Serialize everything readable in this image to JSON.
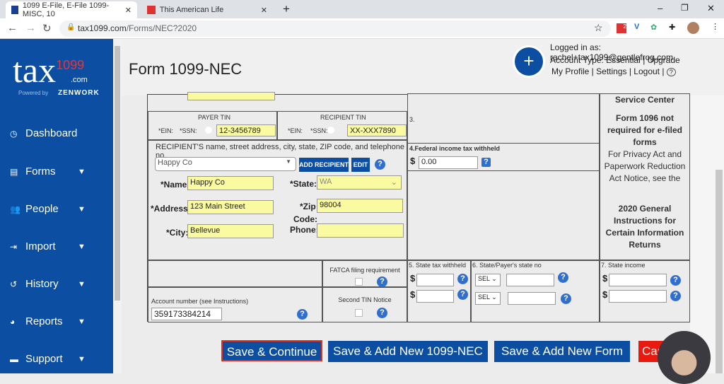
{
  "browser": {
    "tabs": [
      {
        "label": "1099 E-File, E-File 1099-MISC, 10",
        "active": true
      },
      {
        "label": "This American Life",
        "active": false
      }
    ],
    "url_host": "tax1099.com",
    "url_path": "/Forms/NEC?2020",
    "ext_badge": "2"
  },
  "sidebar": {
    "logo": "tax",
    "logo_num": "1099",
    "logo_com": ".com",
    "powered": "Powered by",
    "brand": "ZENWORK",
    "items": [
      {
        "label": "Dashboard",
        "icon": "dashboard-icon",
        "dropdown": false
      },
      {
        "label": "Forms",
        "icon": "forms-icon",
        "dropdown": true
      },
      {
        "label": "People",
        "icon": "people-icon",
        "dropdown": true
      },
      {
        "label": "Import",
        "icon": "import-icon",
        "dropdown": true
      },
      {
        "label": "History",
        "icon": "history-icon",
        "dropdown": true
      },
      {
        "label": "Reports",
        "icon": "reports-icon",
        "dropdown": true
      },
      {
        "label": "Support",
        "icon": "support-icon",
        "dropdown": true
      }
    ]
  },
  "header": {
    "title": "Form 1099-NEC",
    "logged_in": "Logged in as: rachel+tax1099@gentlefrog.com",
    "account_type": "Account Type: Essential",
    "upgrade": "Upgrade",
    "my_profile": "My Profile",
    "settings": "Settings",
    "logout": "Logout",
    "help": "?"
  },
  "form": {
    "payer_tin": "PAYER TIN",
    "recipient_tin": "RECIPIENT TIN",
    "ein": "*EIN:",
    "ssn": "*SSN:",
    "payer_tin_value": "12-3456789",
    "recipient_tin_value": "XX-XXX7890",
    "box3": "3.",
    "box4": "4.Federal income tax withheld",
    "box4_value": "0.00",
    "dollar": "$",
    "recipient_heading": "RECIPIENT'S name, street address, city, state, ZIP code, and telephone no.",
    "recipient_select": "Happy Co",
    "add_recipient": "ADD RECIPIENT",
    "edit": "EDIT",
    "name_label": "*Name",
    "name_value": "Happy Co",
    "address_label": "*Address:",
    "address_value": "123 Main Street",
    "city_label": "*City:",
    "city_value": "Bellevue",
    "state_label": "*State:",
    "state_value": "WA",
    "zip_label": "*Zip",
    "code_label": "Code:",
    "zip_value": "98004",
    "phone_label": "Phone:",
    "phone_value": "",
    "fatca": "FATCA filing requirement",
    "second_tin": "Second TIN Notice",
    "account_label": "Account number (see Instructions)",
    "account_value": "359173384214",
    "box5": "5. State tax withheld",
    "box6": "6. State/Payer's state no",
    "box6_select": "SEL",
    "box7": "7. State income",
    "right_top": "Service Center",
    "right_b1": "Form 1096 not required for e-filed forms",
    "right_n1": "For Privacy Act and Paperwork Reduction Act Notice, see the",
    "right_b2": "2020 General Instructions for Certain Information Returns"
  },
  "actions": {
    "save_continue": "Save & Continue",
    "save_add_nec": "Save & Add New 1099-NEC",
    "save_add_form": "Save & Add New  Form",
    "cancel": "Cancel"
  }
}
